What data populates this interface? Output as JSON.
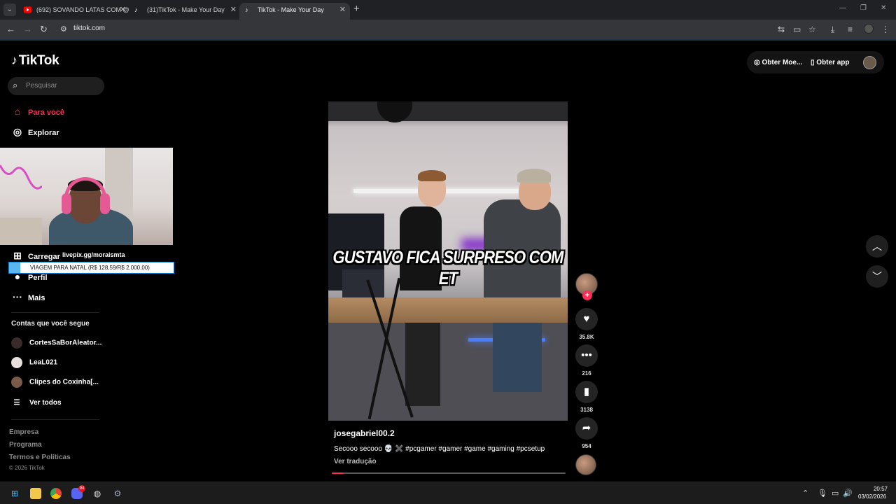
{
  "browser": {
    "tabs": [
      {
        "title": "(692) SOVANDO LATAS COM @",
        "favicon": "youtube-icon"
      },
      {
        "title": "(31)TikTok - Make Your Day",
        "favicon": "tiktok-icon"
      },
      {
        "title": "TikTok - Make Your Day",
        "favicon": "tiktok-icon"
      }
    ],
    "url": "tiktok.com"
  },
  "tiktok": {
    "logo_text": "TikTok",
    "search_placeholder": "Pesquisar",
    "nav": {
      "for_you": "Para você",
      "explore": "Explorar",
      "upload": "Carregar",
      "profile": "Perfil",
      "more": "Mais"
    },
    "following_title": "Contas que você segue",
    "accounts": [
      "CortesSaBorAleator...",
      "LeaL021",
      "Clipes do Coxinha[..."
    ],
    "see_all": "Ver todos",
    "footer": [
      "Empresa",
      "Programa",
      "Termos e Políticas"
    ],
    "copyright": "© 2026 TikTok",
    "top_actions": {
      "coins": "Obter Moe...",
      "get_app": "Obter app"
    },
    "video": {
      "caption_overlay": "GUSTAVO FICA SURPRESO COM ET",
      "author": "josegabriel00.2",
      "description": "Secooo secooo 💀 ✖️ #pcgamer #gamer #game #gaming #pcsetup",
      "translate": "Ver tradução",
      "progress_fraction": 0.05
    },
    "actions": {
      "likes": "35.8K",
      "comments": "216",
      "saves": "3138",
      "shares": "954"
    }
  },
  "stream_overlay": {
    "url_text": "livepix.gg/moraismta",
    "donation_goal": "VIAGEM PARA NATAL (R$ 128,59/R$ 2.000,00)"
  },
  "taskbar": {
    "time": "20:57",
    "date": "03/02/2026",
    "discord_badge": "94"
  },
  "colors": {
    "accent": "#fe2c55",
    "background": "#000000"
  }
}
